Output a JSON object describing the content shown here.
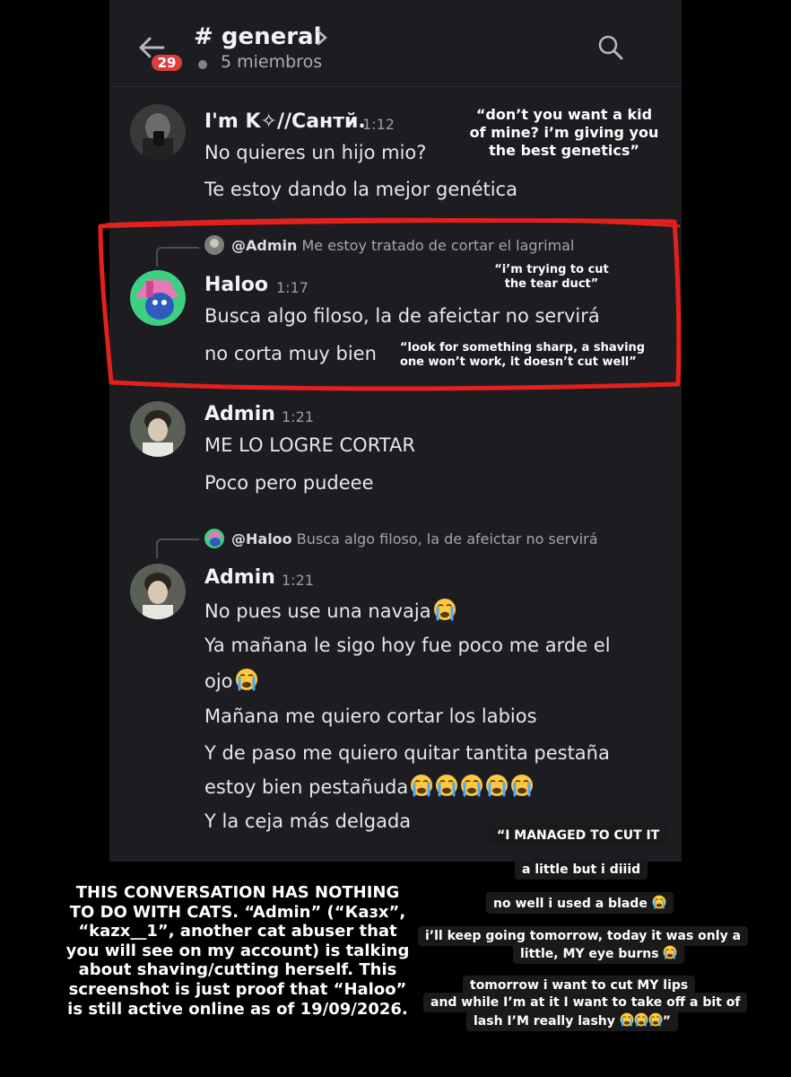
{
  "header": {
    "badge_count": "29",
    "channel_title": "# general",
    "members_label": "5 miembros"
  },
  "messages": [
    {
      "user": "I'm K✧//Сантй.",
      "time": "1:12",
      "lines": [
        "No quieres un hijo mio?",
        "Te estoy dando la mejor genética"
      ],
      "translation": "“don’t you want a kid of mine? i’m giving you the best genetics”",
      "translation_lines": [
        "“don’t you want a kid",
        "of mine? i’m giving you",
        "the best genetics”"
      ]
    },
    {
      "reply_user": "@Admin",
      "reply_text": "Me estoy tratado de cortar el lagrimal",
      "user": "Haloo",
      "time": "1:17",
      "lines": [
        "Busca algo filoso, la de afeictar no servirá",
        "no corta muy bien"
      ],
      "reply_translation_lines": [
        "“i’m trying to cut",
        "the tear duct”"
      ],
      "translation_lines": [
        "“look for something sharp, a shaving",
        "one won’t work, it doesn’t cut well”"
      ]
    },
    {
      "user": "Admin",
      "time": "1:21",
      "lines": [
        "ME LO LOGRE CORTAR",
        "Poco pero pudeee"
      ]
    },
    {
      "reply_user": "@Haloo",
      "reply_text": "Busca algo filoso, la de afeictar no servirá",
      "user": "Admin",
      "time": "1:21",
      "lines": [
        "No pues use una navaja",
        "Ya mañana le sigo hoy fue poco me arde el",
        "ojo",
        "Mañana me quiero cortar los labios",
        "Y de paso me quiero quitar tantita pestaña",
        "estoy bien pestañuda",
        "Y la ceja más delgada"
      ]
    }
  ],
  "translations_bottom": [
    "“I MANAGED TO CUT IT",
    "a little but i diiid",
    "no well i used a blade",
    "i’ll keep going tomorrow, today it was only a",
    "little, MY eye burns",
    "tomorrow i want to cut MY lips",
    "and while I’m at it I want to take off a bit of",
    "lash I’M really lashy"
  ],
  "translations_bottom_tail": "”",
  "disclaimer_lines": [
    "THIS CONVERSATION HAS NOTHING",
    "TO DO WITH CATS. “Admin” (“Казх”,",
    "“kazx__1”, another cat abuser that",
    "you will see on my account) is talking",
    "about shaving/cutting herself. This",
    "screenshot is just proof that “Haloo”",
    "is still active online as of 19/09/2026."
  ],
  "colors": {
    "panel": "#1c1c21",
    "highlight_box": "#e3201b",
    "badge": "#e03c3c"
  },
  "icons": [
    "back-arrow-icon",
    "search-icon",
    "chevron-right-icon",
    "crying-face-emoji"
  ]
}
